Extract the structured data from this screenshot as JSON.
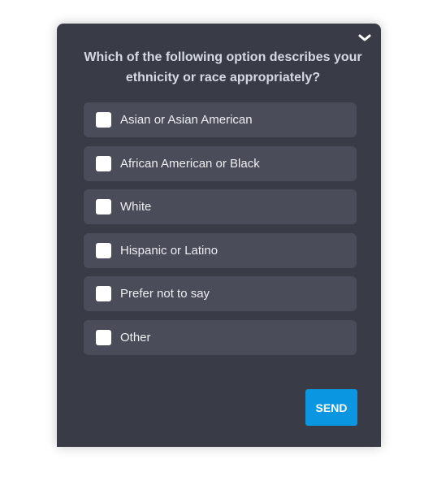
{
  "question": "Which of the following option describes your ethnicity or race appropriately?",
  "options": [
    {
      "label": "Asian or Asian American",
      "checked": false
    },
    {
      "label": "African American or Black",
      "checked": false
    },
    {
      "label": "White",
      "checked": false
    },
    {
      "label": "Hispanic or Latino",
      "checked": false
    },
    {
      "label": "Prefer not to say",
      "checked": false
    },
    {
      "label": "Other",
      "checked": false
    }
  ],
  "send_label": "SEND",
  "colors": {
    "panel": "#393c46",
    "option": "#4a4d59",
    "accent": "#0a96e0"
  },
  "icons": {
    "collapse": "chevron-down-icon"
  }
}
